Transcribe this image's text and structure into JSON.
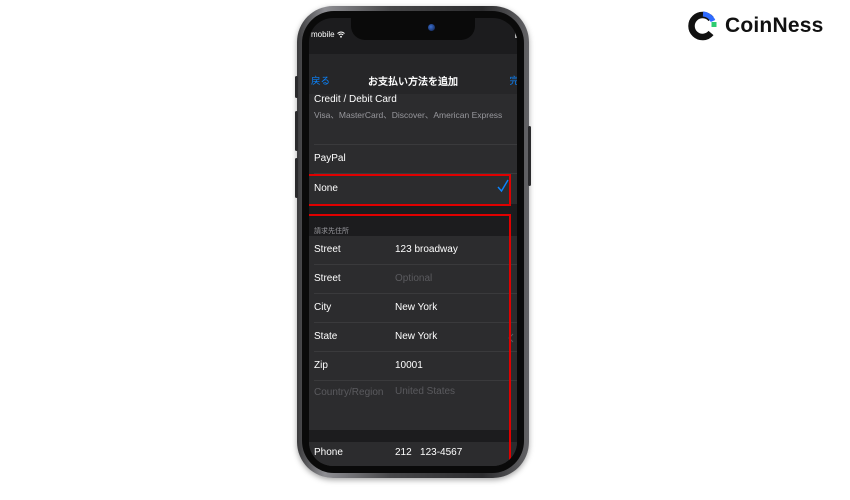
{
  "brand": {
    "name": "CoinNess",
    "colors": {
      "blue": "#2f6bff",
      "green": "#2ecc71",
      "dark": "#111111"
    }
  },
  "status_bar": {
    "carrier": "mobile",
    "wifi_icon": "wifi-icon"
  },
  "navbar": {
    "back_label": "戻る",
    "title": "お支払い方法を追加",
    "done_label": "完"
  },
  "payment_methods": {
    "card_title": "Credit / Debit Card",
    "card_subtitle": "Visa、MasterCard、Discover、American Express",
    "paypal_label": "PayPal",
    "none_label": "None",
    "selected": "None"
  },
  "billing_section": {
    "header": "請求先住所",
    "rows": [
      {
        "label": "Street",
        "value": "123 broadway",
        "placeholder": ""
      },
      {
        "label": "Street",
        "value": "",
        "placeholder": "Optional"
      },
      {
        "label": "City",
        "value": "New York",
        "placeholder": ""
      },
      {
        "label": "State",
        "value": "New York",
        "placeholder": ""
      },
      {
        "label": "Zip",
        "value": "10001",
        "placeholder": ""
      },
      {
        "label": "Country/Region",
        "value": "United States",
        "placeholder": ""
      }
    ],
    "phone": {
      "label": "Phone",
      "value": "212   123-4567"
    }
  },
  "highlight_color": "#e00000"
}
